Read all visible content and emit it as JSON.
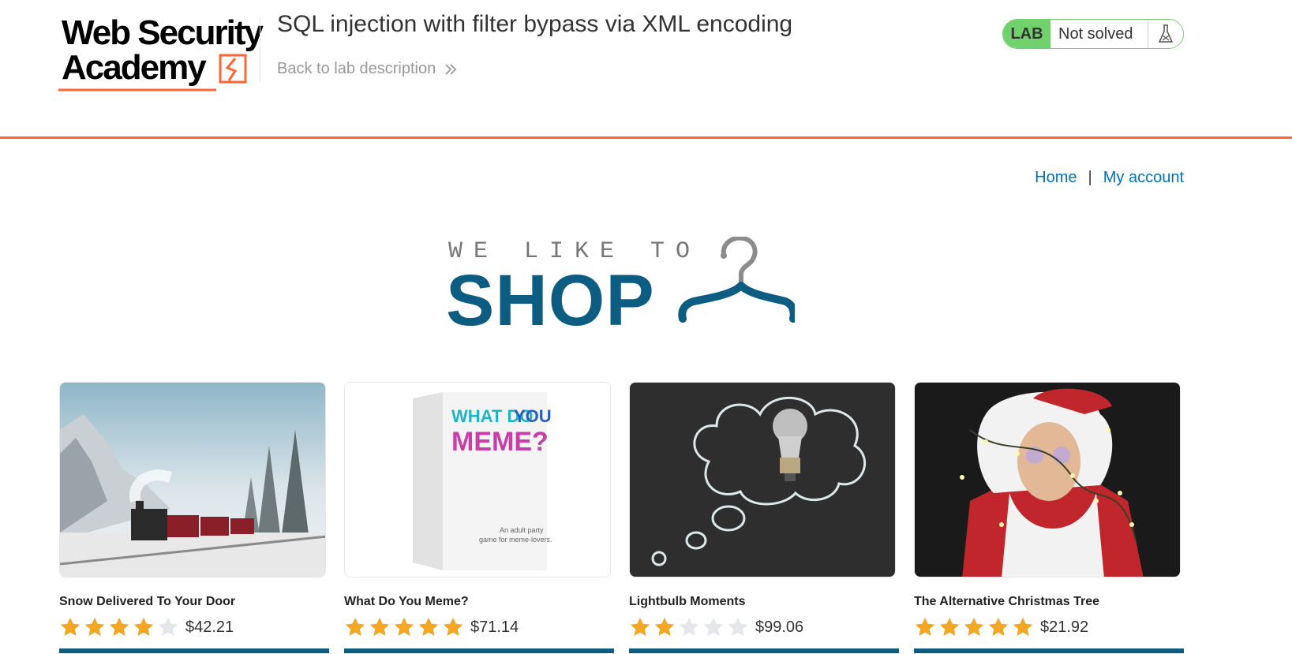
{
  "academy": {
    "logo_line1": "Web Security",
    "logo_line2": "Academy",
    "lab_title": "SQL injection with filter bypass via XML encoding",
    "back_link": "Back to lab description",
    "lab_tag": "LAB",
    "lab_state": "Not solved"
  },
  "nav": {
    "home": "Home",
    "separator": "|",
    "account": "My account"
  },
  "banner": {
    "small_text": "WE LIKE TO",
    "big_text": "SHOP"
  },
  "colors": {
    "accent_orange": "#ff6633",
    "status_green": "#70d16d",
    "shop_blue": "#0d5c82",
    "link_blue": "#0071bc",
    "star_gold": "#f5a623"
  },
  "products": [
    {
      "name": "Snow Delivered To Your Door",
      "rating": 4,
      "price": "$42.21",
      "image_icon": "snowy-train-photo"
    },
    {
      "name": "What Do You Meme?",
      "rating": 5,
      "price": "$71.14",
      "image_icon": "meme-card-box-photo",
      "box_text": [
        "WHAT DO ",
        "YOU",
        "MEME?",
        "An adult party",
        "game for meme-lovers."
      ]
    },
    {
      "name": "Lightbulb Moments",
      "rating": 2,
      "price": "$99.06",
      "image_icon": "lightbulb-chalkboard-photo"
    },
    {
      "name": "The Alternative Christmas Tree",
      "rating": 5,
      "price": "$21.92",
      "image_icon": "santa-lights-photo"
    }
  ]
}
